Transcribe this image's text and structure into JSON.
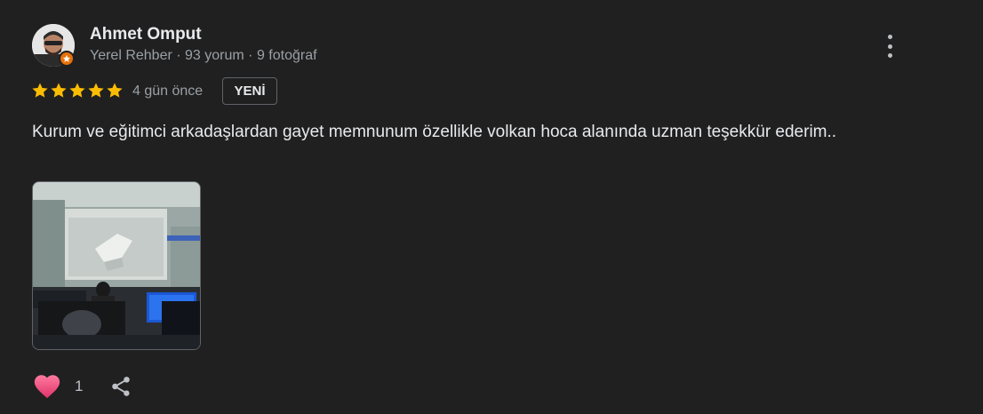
{
  "review": {
    "author_name": "Ahmet Omput",
    "author_meta": "Yerel Rehber · 93 yorum · 9 fotoğraf",
    "rating": 5,
    "rating_max": 5,
    "date": "4 gün önce",
    "new_badge": "YENİ",
    "text": "Kurum ve eğitimci arkadaşlardan gayet memnunum özellikle volkan hoca alanında uzman teşekkür ederim..",
    "like_count": "1"
  },
  "colors": {
    "background": "#202020",
    "star": "#fbbc04",
    "guide_badge": "#e8710a",
    "heart": "#ee4f7f"
  },
  "icons": {
    "more": "more-vert-icon",
    "like": "heart-icon",
    "share": "share-icon",
    "guide": "local-guide-star-icon"
  }
}
